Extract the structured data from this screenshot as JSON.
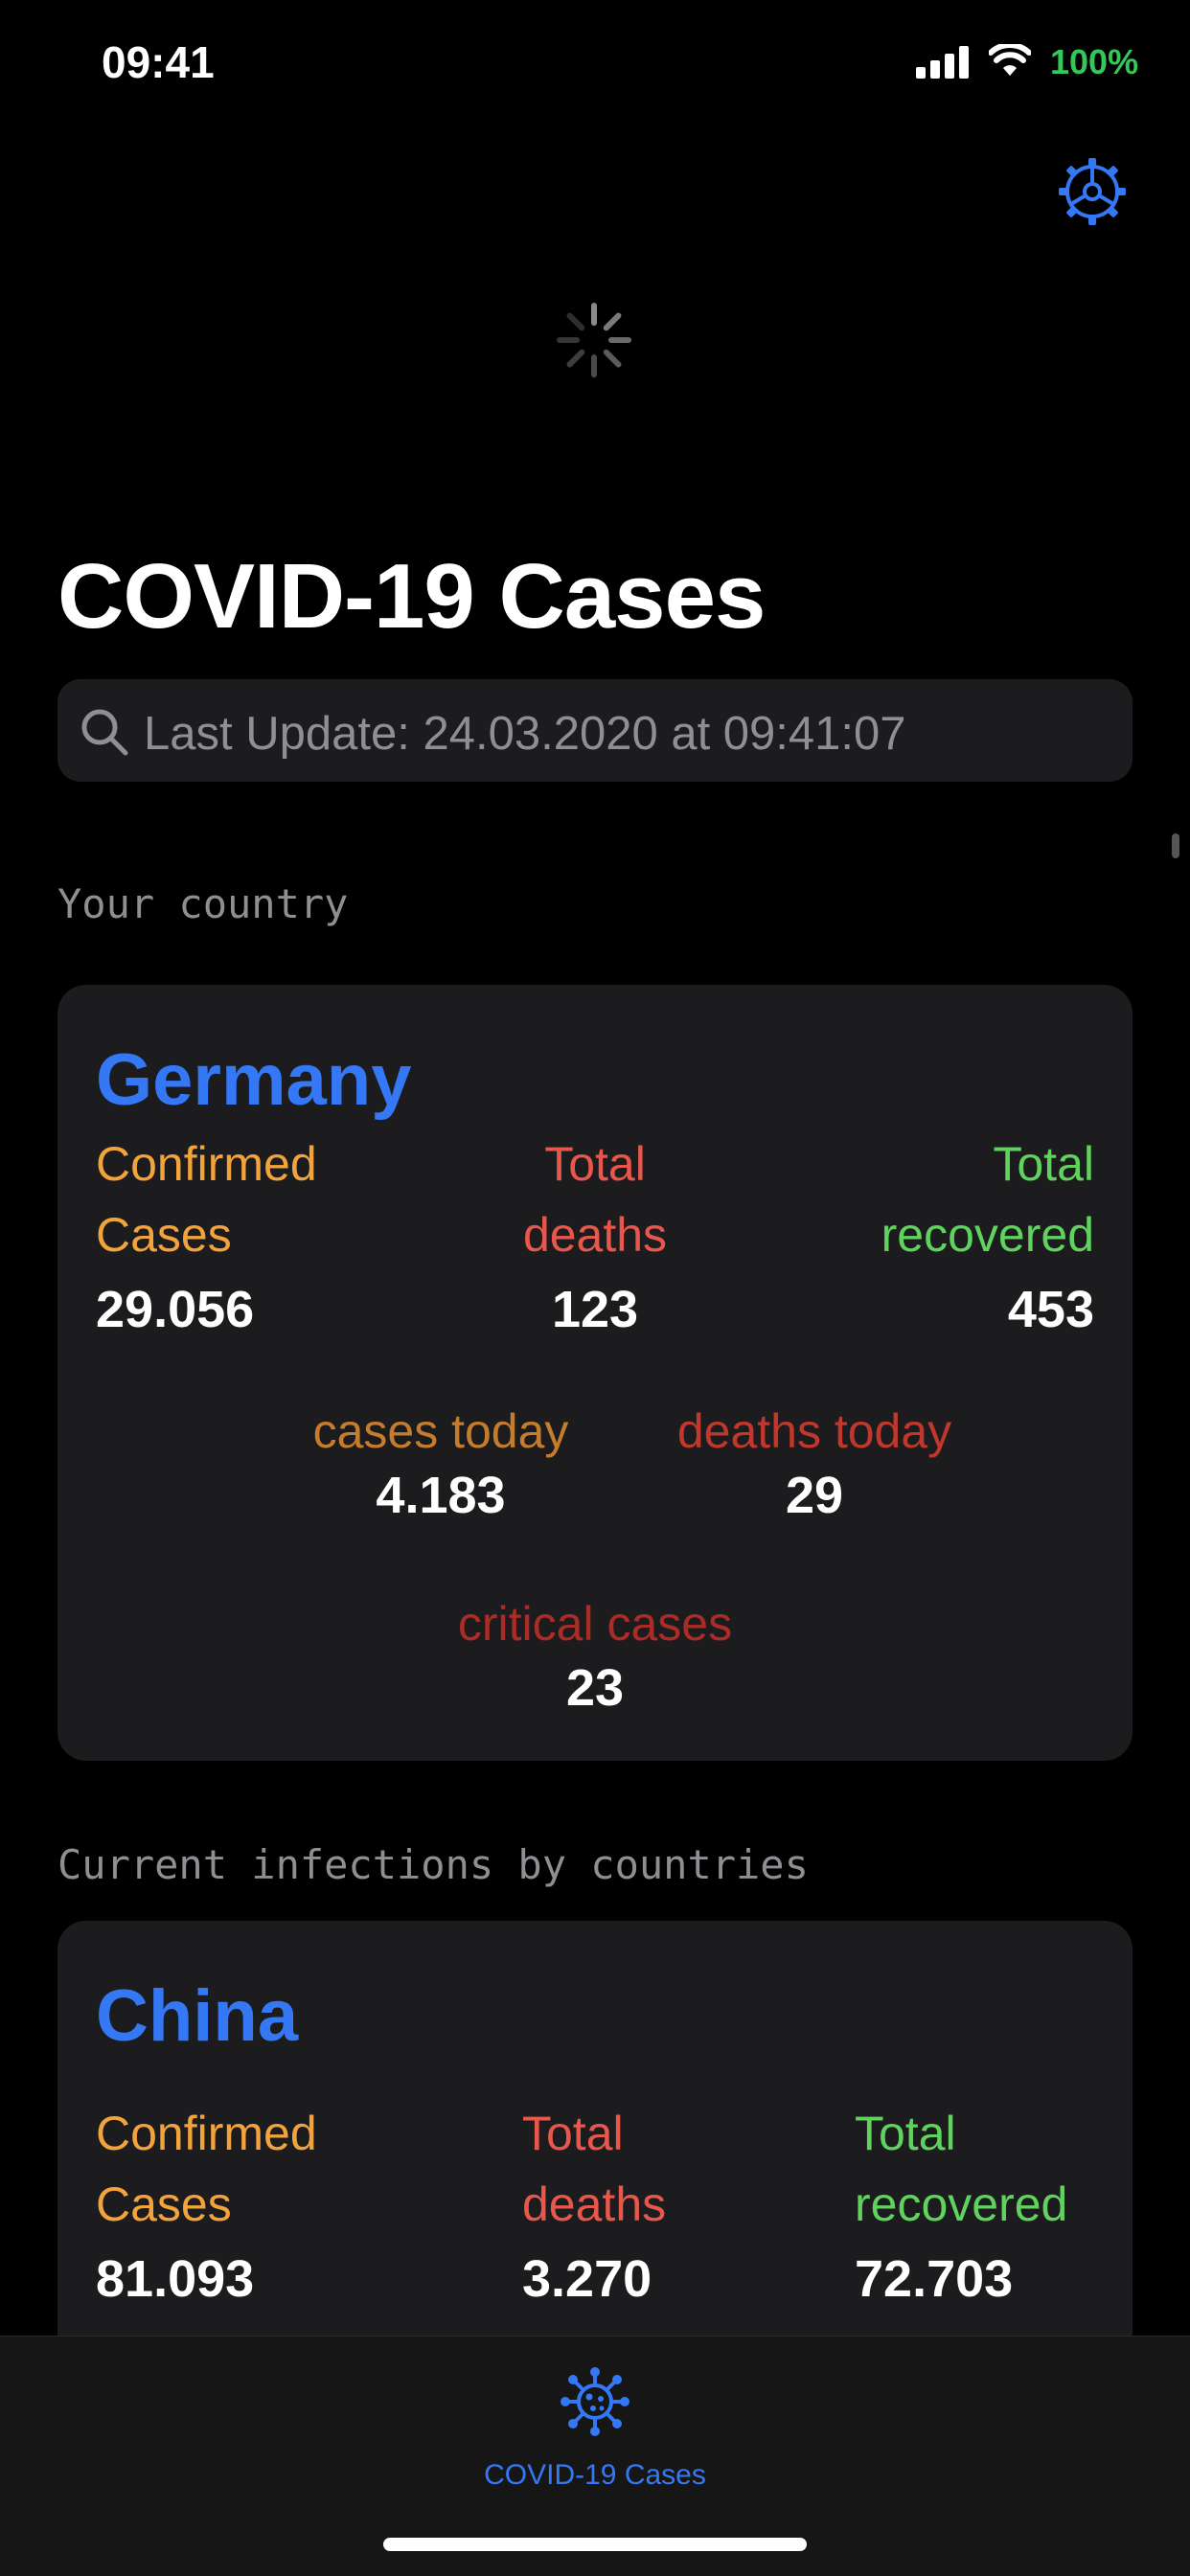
{
  "status_bar": {
    "time": "09:41",
    "battery": "100%"
  },
  "icons": {
    "settings": "gear-icon",
    "loading": "activity-spinner-icon",
    "search": "magnifier-icon",
    "tab": "virus-icon"
  },
  "colors": {
    "accent": "#3478f6",
    "confirmed": "#f2a33c",
    "deaths": "#e8574b",
    "recovered": "#5fd35d",
    "critical": "#a92c26"
  },
  "title": "COVID-19 Cases",
  "search": {
    "text": "Last Update: 24.03.2020 at 09:41:07"
  },
  "sections": {
    "your_country": "Your country",
    "by_countries": "Current infections by countries"
  },
  "your_country": {
    "name": "Germany",
    "confirmed_l1": "Confirmed",
    "confirmed_l2": "Cases",
    "confirmed": "29.056",
    "deaths_l1": "Total",
    "deaths_l2": "deaths",
    "deaths": "123",
    "recovered_l1": "Total",
    "recovered_l2": "recovered",
    "recovered": "453",
    "cases_today_label": "cases today",
    "cases_today": "4.183",
    "deaths_today_label": "deaths today",
    "deaths_today": "29",
    "critical_label": "critical cases",
    "critical": "23"
  },
  "countries": [
    {
      "name": "China",
      "confirmed_l1": "Confirmed",
      "confirmed_l2": "Cases",
      "confirmed": "81.093",
      "deaths_l1": "Total",
      "deaths_l2": "deaths",
      "deaths": "3.270",
      "recovered_l1": "Total",
      "recovered_l2": "recovered",
      "recovered": "72.703"
    }
  ],
  "tab_bar": {
    "label": "COVID-19 Cases"
  }
}
